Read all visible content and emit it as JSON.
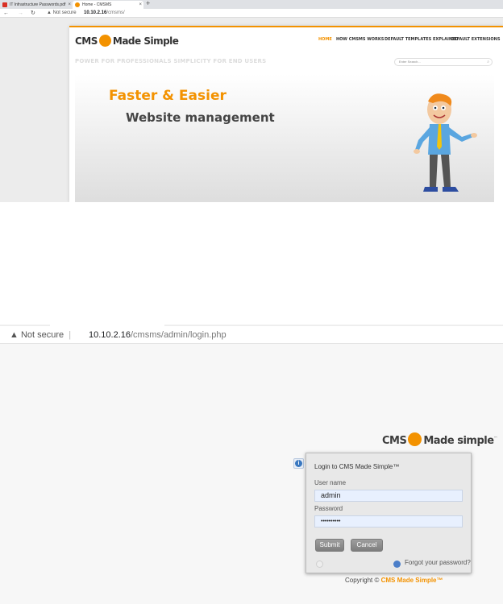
{
  "browser1": {
    "tabs": [
      {
        "label": "IT Infrastructure Passwords.pdf",
        "color": "#d93025"
      },
      {
        "label": "Home - CMSMS",
        "color": "#f39200"
      }
    ],
    "new_tab": "+",
    "nav": {
      "back": "←",
      "forward": "→",
      "reload": "↻"
    },
    "security": "▲ Not secure",
    "url_host": "10.10.2.16",
    "url_path": "/cmsms/"
  },
  "site": {
    "logo_left": "CMS",
    "logo_right": "Made Simple",
    "nav": [
      "HOME",
      "HOW CMSMS WORKS",
      "DEFAULT TEMPLATES EXPLAINED",
      "DEFAULT EXTENSIONS"
    ],
    "tagline": "POWER FOR PROFESSIONALS SIMPLICITY FOR END USERS",
    "search_placeholder": "Enter Search...",
    "banner_line1": "Faster & Easier",
    "banner_line2": "Website management",
    "accent": "#f39200"
  },
  "browser2": {
    "security": "▲  Not secure",
    "separator": "|",
    "url_host": "10.10.2.16",
    "url_path": "/cmsms/admin/login.php"
  },
  "login": {
    "logo_left": "CMS",
    "logo_right": "Made simple",
    "logo_tm": "™",
    "title": "Login to CMS Made Simple™",
    "username_label": "User name",
    "username_value": "admin",
    "password_label": "Password",
    "password_value": "••••••••••",
    "submit_label": "Submit",
    "cancel_label": "Cancel",
    "forgot_label": "Forgot your password?",
    "copyright_prefix": "Copyright ©",
    "copyright_brand": "CMS Made Simple™"
  }
}
